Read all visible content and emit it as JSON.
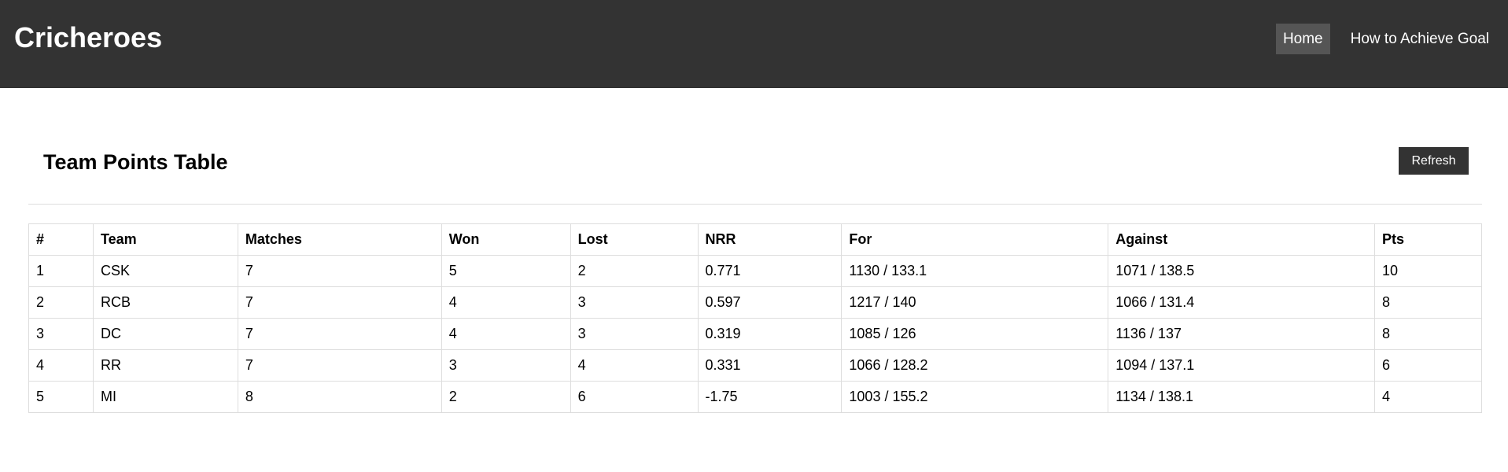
{
  "header": {
    "brand": "Cricheroes",
    "nav": [
      {
        "label": "Home",
        "active": true
      },
      {
        "label": "How to Achieve Goal",
        "active": false
      }
    ]
  },
  "main": {
    "title": "Team Points Table",
    "refresh_label": "Refresh",
    "table": {
      "columns": [
        "#",
        "Team",
        "Matches",
        "Won",
        "Lost",
        "NRR",
        "For",
        "Against",
        "Pts"
      ],
      "rows": [
        [
          "1",
          "CSK",
          "7",
          "5",
          "2",
          "0.771",
          "1130 / 133.1",
          "1071 / 138.5",
          "10"
        ],
        [
          "2",
          "RCB",
          "7",
          "4",
          "3",
          "0.597",
          "1217 / 140",
          "1066 / 131.4",
          "8"
        ],
        [
          "3",
          "DC",
          "7",
          "4",
          "3",
          "0.319",
          "1085 / 126",
          "1136 / 137",
          "8"
        ],
        [
          "4",
          "RR",
          "7",
          "3",
          "4",
          "0.331",
          "1066 / 128.2",
          "1094 / 137.1",
          "6"
        ],
        [
          "5",
          "MI",
          "8",
          "2",
          "6",
          "-1.75",
          "1003 / 155.2",
          "1134 / 138.1",
          "4"
        ]
      ]
    }
  },
  "colors": {
    "header_bg": "#333333",
    "nav_active_bg": "#555555",
    "button_bg": "#333333",
    "border": "#dddddd"
  }
}
